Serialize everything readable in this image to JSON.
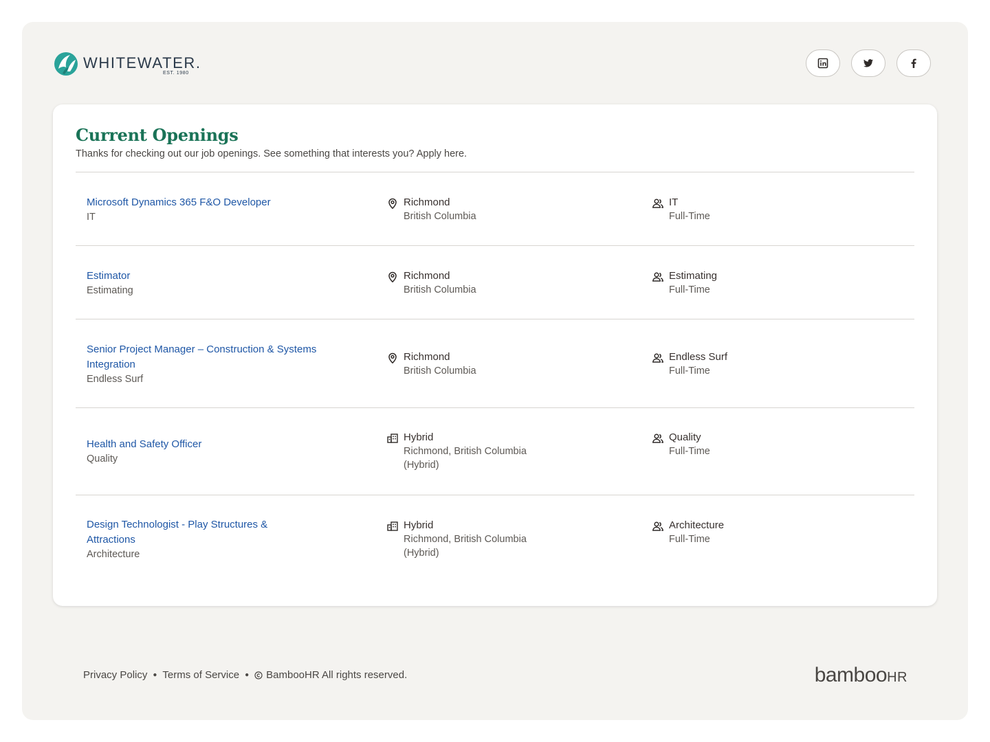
{
  "header": {
    "logo_name": "WHITEWATER.",
    "logo_tagline": "EST. 1980",
    "socials": [
      {
        "name": "linkedin",
        "icon": "linkedin-icon"
      },
      {
        "name": "twitter",
        "icon": "twitter-icon"
      },
      {
        "name": "facebook",
        "icon": "facebook-icon"
      }
    ]
  },
  "openings": {
    "title": "Current Openings",
    "subtitle": "Thanks for checking out our job openings. See something that interests you? Apply here.",
    "jobs": [
      {
        "title": "Microsoft Dynamics 365 F&O Developer",
        "department": "IT",
        "location_type": "Richmond",
        "location_detail": "British Columbia",
        "location_icon": "map-pin-icon",
        "dept_label": "IT",
        "employment": "Full-Time"
      },
      {
        "title": "Estimator",
        "department": "Estimating",
        "location_type": "Richmond",
        "location_detail": "British Columbia",
        "location_icon": "map-pin-icon",
        "dept_label": "Estimating",
        "employment": "Full-Time"
      },
      {
        "title": "Senior Project Manager – Construction & Systems Integration",
        "department": "Endless Surf",
        "location_type": "Richmond",
        "location_detail": "British Columbia",
        "location_icon": "map-pin-icon",
        "dept_label": "Endless Surf",
        "employment": "Full-Time"
      },
      {
        "title": "Health and Safety Officer",
        "department": "Quality",
        "location_type": "Hybrid",
        "location_detail": "Richmond, British Columbia (Hybrid)",
        "location_icon": "building-icon",
        "dept_label": "Quality",
        "employment": "Full-Time"
      },
      {
        "title": "Design Technologist - Play Structures & Attractions",
        "department": "Architecture",
        "location_type": "Hybrid",
        "location_detail": "Richmond, British Columbia (Hybrid)",
        "location_icon": "building-icon",
        "dept_label": "Architecture",
        "employment": "Full-Time"
      }
    ]
  },
  "footer": {
    "privacy": "Privacy Policy",
    "terms": "Terms of Service",
    "copyright": "BambooHR All rights reserved.",
    "brand": "bamboo",
    "brand_suffix": "HR"
  },
  "colors": {
    "title_green": "#1a7357",
    "link_blue": "#1f57a6",
    "background": "#f4f3f0"
  }
}
